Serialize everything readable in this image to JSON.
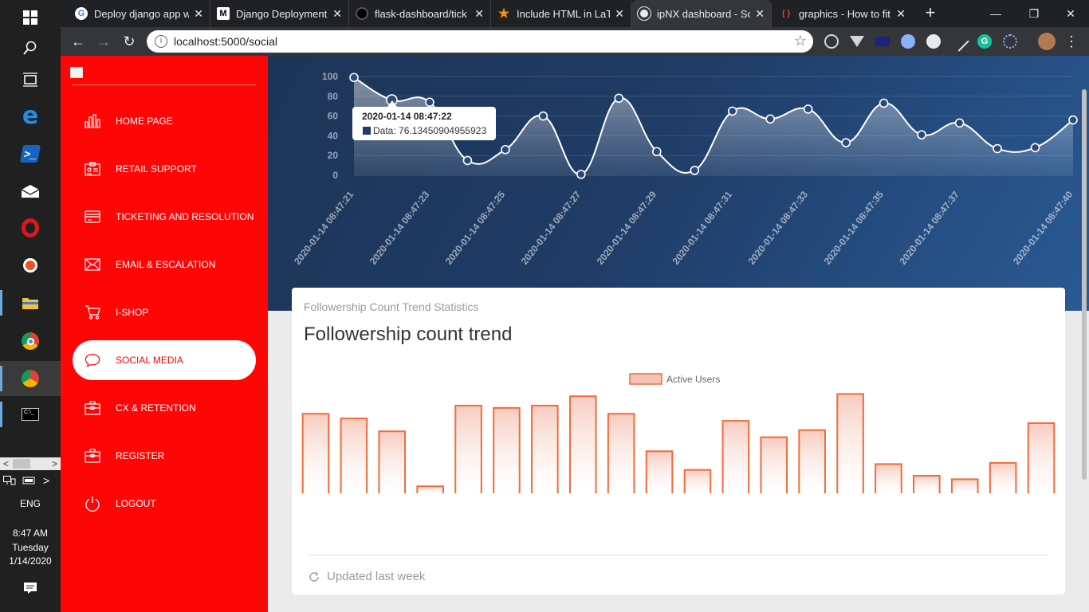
{
  "taskbar": {
    "icons": [
      "windows-start-icon",
      "search-icon",
      "task-view-icon",
      "edge-icon",
      "powershell-icon",
      "mail-icon",
      "opera-icon",
      "ubuntu-icon",
      "file-explorer-icon",
      "chrome-icon",
      "chrome-profile-icon",
      "terminal-icon"
    ],
    "language": "ENG",
    "time": "8:47 AM",
    "day": "Tuesday",
    "date": "1/14/2020"
  },
  "browser": {
    "tabs": [
      {
        "title": "Deploy django app w",
        "favicon": "google-icon"
      },
      {
        "title": "Django Deployment (",
        "favicon": "medium-icon"
      },
      {
        "title": "flask-dashboard/tick",
        "favicon": "github-icon"
      },
      {
        "title": "Include HTML in LaTe",
        "favicon": "star-icon"
      },
      {
        "title": "ipNX dashboard - So",
        "favicon": "globe-icon"
      },
      {
        "title": "graphics - How to fit",
        "favicon": "code-icon"
      }
    ],
    "active_tab": 4,
    "url": "localhost:5000/social"
  },
  "sidebar": {
    "items": [
      {
        "label": "HOME PAGE",
        "icon": "bar-chart-icon"
      },
      {
        "label": "RETAIL SUPPORT",
        "icon": "id-card-icon"
      },
      {
        "label": "TICKETING AND RESOLUTION",
        "icon": "credit-card-icon"
      },
      {
        "label": "EMAIL & ESCALATION",
        "icon": "envelope-icon"
      },
      {
        "label": "I-SHOP",
        "icon": "cart-icon"
      },
      {
        "label": "SOCIAL MEDIA",
        "icon": "chat-bubble-icon"
      },
      {
        "label": "CX & RETENTION",
        "icon": "briefcase-icon"
      },
      {
        "label": "REGISTER",
        "icon": "briefcase-icon"
      },
      {
        "label": "LOGOUT",
        "icon": "power-icon"
      }
    ],
    "active_index": 5
  },
  "colors": {
    "sidebar_red": "#fd0606",
    "bar_stroke": "#f26b3a",
    "bar_fill_top": "#f5c2b4",
    "panel_blue": "#1f3c66"
  },
  "line_chart": {
    "tooltip": {
      "title": "2020-01-14 08:47:22",
      "label": "Data: 76.13450904955923"
    },
    "chart_data": {
      "type": "line",
      "x": [
        "2020-01-14 08:47:21",
        "2020-01-14 08:47:22",
        "2020-01-14 08:47:23",
        "2020-01-14 08:47:24",
        "2020-01-14 08:47:25",
        "2020-01-14 08:47:26",
        "2020-01-14 08:47:27",
        "2020-01-14 08:47:28",
        "2020-01-14 08:47:29",
        "2020-01-14 08:47:30",
        "2020-01-14 08:47:31",
        "2020-01-14 08:47:32",
        "2020-01-14 08:47:33",
        "2020-01-14 08:47:34",
        "2020-01-14 08:47:35",
        "2020-01-14 08:47:36",
        "2020-01-14 08:47:37",
        "2020-01-14 08:47:38",
        "2020-01-14 08:47:39",
        "2020-01-14 08:47:40"
      ],
      "tick_labels": [
        "2020-01-14 08:47:21",
        "2020-01-14 08:47:23",
        "2020-01-14 08:47:25",
        "2020-01-14 08:47:27",
        "2020-01-14 08:47:29",
        "2020-01-14 08:47:31",
        "2020-01-14 08:47:33",
        "2020-01-14 08:47:35",
        "2020-01-14 08:47:37",
        "2020-01-14 08:47:40"
      ],
      "tick_indices": [
        0,
        2,
        4,
        6,
        8,
        10,
        12,
        14,
        16,
        19
      ],
      "values": [
        99,
        76.13,
        74,
        15,
        26,
        60,
        1,
        78,
        24,
        5,
        65,
        57,
        67,
        33,
        73,
        41,
        53,
        27,
        28,
        56
      ],
      "yticks": [
        0,
        20,
        40,
        60,
        80,
        100
      ],
      "ylim": [
        0,
        100
      ],
      "grid": true,
      "title": "",
      "xlabel": "",
      "ylabel": ""
    }
  },
  "card": {
    "category": "Followership Count Trend Statistics",
    "title": "Followership count trend",
    "footer": "Updated last week",
    "chart_data": {
      "type": "bar",
      "legend": "Active Users",
      "legend_position": "top-center",
      "values": [
        68,
        64,
        53,
        6,
        75,
        73,
        75,
        83,
        68,
        36,
        20,
        62,
        48,
        54,
        85,
        25,
        15,
        12,
        26,
        60
      ],
      "ylim": [
        0,
        90
      ],
      "title": "",
      "xlabel": "",
      "ylabel": ""
    }
  }
}
